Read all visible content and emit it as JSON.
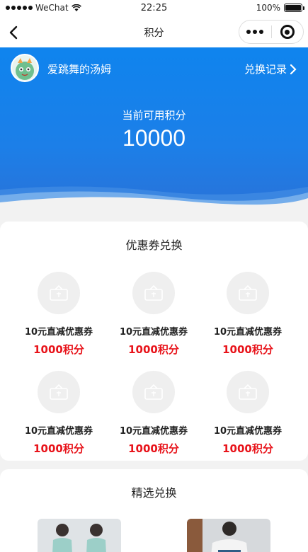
{
  "status_bar": {
    "carrier": "WeChat",
    "time": "22:25",
    "battery": "100%"
  },
  "nav": {
    "title": "积分"
  },
  "header": {
    "username": "爱跳舞的汤姆",
    "record_link": "兑换记录",
    "points_label": "当前可用积分",
    "points_value": "10000"
  },
  "coupons": {
    "title": "优惠券兑换",
    "items": [
      {
        "name": "10元直减优惠券",
        "cost": "1000积分"
      },
      {
        "name": "10元直减优惠券",
        "cost": "1000积分"
      },
      {
        "name": "10元直减优惠券",
        "cost": "1000积分"
      },
      {
        "name": "10元直减优惠券",
        "cost": "1000积分"
      },
      {
        "name": "10元直减优惠券",
        "cost": "1000积分"
      },
      {
        "name": "10元直减优惠券",
        "cost": "1000积分"
      }
    ]
  },
  "featured": {
    "title": "精选兑换"
  },
  "colors": {
    "header_blue": "#0f84ee",
    "cost_red": "#e8141b"
  },
  "icons": [
    "back-icon",
    "more-icon",
    "miniprogram-close-icon",
    "chevron-right-icon",
    "coupon-icon",
    "wifi-icon",
    "battery-icon"
  ]
}
